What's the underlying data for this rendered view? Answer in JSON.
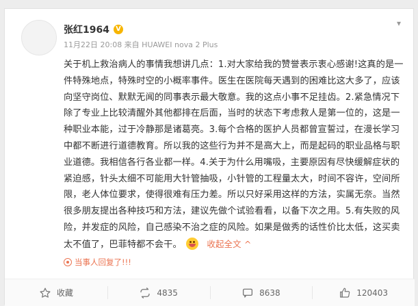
{
  "post": {
    "username": "张红1964",
    "vip_label": "V",
    "meta": "11月22日 20:08 来自 HUAWEI nova 2 Plus",
    "content_paragraphs": [
      "关于机上救治病人的事情我想讲几点：1.对大家给我的赞誉表示衷心感谢!这真的是一件特殊地点，特殊时空的小概率事件。医生在医院每天遇到的困难比这大多了，应该向坚守岗位、默默无闻的同事表示最大敬意。我的这点小事不足挂齿。2.紧急情况下除了专业上比较清醒外其他都排在后面，当时的状态下考虑救人是第一位的，这是一种职业本能，过于冷静那是诸葛亮。3.每个合格的医护人员都曾宣誓过，在漫长学习中都不断进行道德教育。所以我的这些行为并不是高大上，而是起码的职业品格与职业道德。我相信各行各业都一样。4.关于为什么用嘴吸，主要原因有尽快缓解症状的紧迫感，针头太细不可能用大针管抽吸，小针管的工程量太大，时间不容许，空间所限，老人体位要求，使得很难有压力差。所以只好采用这样的方法，实属无奈。当然很多朋友提出各种技巧和方法，建议先做个试验看看，以备下次之用。5.有失败的风险，并发症的风险，自己感染不治之症的风险。如果是做秀的话性价比太低，这买卖太不值了，巴菲特都不会干。"
    ],
    "emoji": "smile-emoji",
    "collapse_label": "收起全文",
    "collapse_arrow": "^",
    "notice": "当事人回复了!!!"
  },
  "actions": {
    "favorite": {
      "label": "收藏",
      "icon": "star-icon"
    },
    "repost": {
      "count": "4835",
      "icon": "repost-icon"
    },
    "comment": {
      "count": "8638",
      "icon": "comment-icon"
    },
    "like": {
      "count": "120403",
      "icon": "thumbs-up-icon"
    }
  },
  "colors": {
    "accent": "#eb7350",
    "text": "#333333",
    "meta": "#999999"
  }
}
